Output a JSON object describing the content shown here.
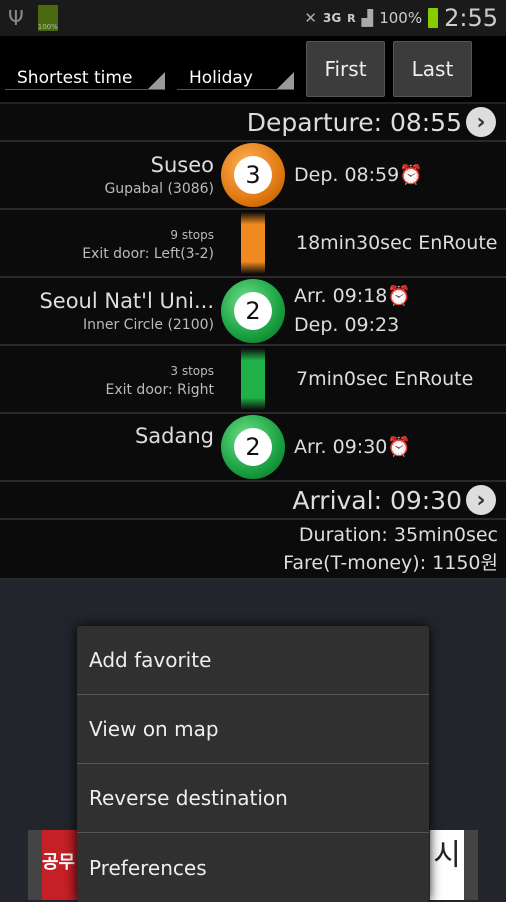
{
  "status": {
    "battery_small": "100%",
    "network": "3G",
    "roaming": "R",
    "battery": "100%",
    "time": "2:55"
  },
  "toolbar": {
    "sort": "Shortest time",
    "day": "Holiday",
    "first": "First",
    "last": "Last"
  },
  "departure": "Departure: 08:55",
  "stations": [
    {
      "name": "Suseo",
      "line": "Gupabal (3086)",
      "number": "3",
      "color": "#f08a20",
      "times": [
        "Dep. 08:59"
      ]
    },
    {
      "name": "Seoul Nat'l Uni...",
      "line": "Inner Circle (2100)",
      "number": "2",
      "color": "#20b048",
      "times": [
        "Arr. 09:18",
        "Dep. 09:23"
      ]
    },
    {
      "name": "Sadang",
      "line": "",
      "number": "2",
      "color": "#20b048",
      "times": [
        "Arr. 09:30"
      ]
    }
  ],
  "segments": [
    {
      "stops": "9 stops",
      "door": "Exit door: Left(3-2)",
      "duration": "18min30sec EnRoute"
    },
    {
      "stops": "3 stops",
      "door": "Exit door: Right",
      "duration": "7min0sec EnRoute"
    }
  ],
  "arrival": "Arrival: 09:30",
  "duration": "Duration: 35min0sec",
  "fare": "Fare(T-money): 1150원",
  "ad": {
    "left_text": "공무",
    "right_text": "시"
  },
  "menu": [
    "Add favorite",
    "View on map",
    "Reverse destination",
    "Preferences"
  ]
}
